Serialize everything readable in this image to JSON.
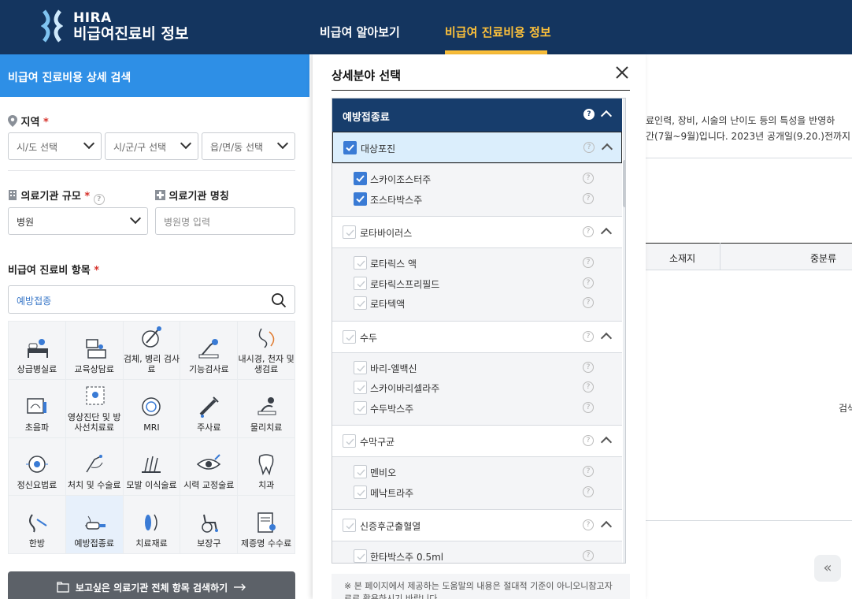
{
  "header": {
    "logo_line1": "HIRA",
    "logo_line2": "비급여진료비 정보",
    "nav": [
      "비급여 알아보기",
      "비급여 진료비용 정보"
    ],
    "colors": {
      "header_bg": "#14355f",
      "accent": "#ffc23a",
      "primary": "#2e8fe6"
    }
  },
  "left": {
    "title": "비급여 진료비용 상세 검색",
    "region_label": "지역",
    "req": "*",
    "region_selects": [
      "시/도 선택",
      "시/군/구 선택",
      "읍/면/동 선택"
    ],
    "scale_label": "의료기관 규모",
    "scale_value": "병원",
    "name_label": "의료기관 명칭",
    "name_placeholder": "병원명 입력",
    "items_label": "비급여 진료비 항목",
    "search_value": "예방접종",
    "grid": [
      {
        "label": "상급병실료",
        "icon": "bed-icon"
      },
      {
        "label": "교육상담료",
        "icon": "counseling-icon"
      },
      {
        "label": "검체, 병리 검사료",
        "icon": "lab-icon"
      },
      {
        "label": "기능검사료",
        "icon": "function-test-icon"
      },
      {
        "label": "내시경, 천자 및 생검료",
        "icon": "endoscope-icon"
      },
      {
        "label": "초음파",
        "icon": "ultrasound-icon"
      },
      {
        "label": "영상진단 및 방사선치료료",
        "icon": "radiology-icon"
      },
      {
        "label": "MRI",
        "icon": "mri-icon"
      },
      {
        "label": "주사료",
        "icon": "syringe-icon"
      },
      {
        "label": "물리치료",
        "icon": "physio-icon"
      },
      {
        "label": "정신요법료",
        "icon": "brain-icon"
      },
      {
        "label": "처치 및 수술료",
        "icon": "surgery-icon"
      },
      {
        "label": "모발 이식술료",
        "icon": "hair-icon"
      },
      {
        "label": "시력 교정술료",
        "icon": "eye-icon"
      },
      {
        "label": "치과",
        "icon": "tooth-icon"
      },
      {
        "label": "한방",
        "icon": "acupuncture-icon"
      },
      {
        "label": "예방접종료",
        "icon": "vaccine-icon"
      },
      {
        "label": "치료재료",
        "icon": "material-icon"
      },
      {
        "label": "보장구",
        "icon": "wheelchair-icon"
      },
      {
        "label": "제증명 수수료",
        "icon": "certificate-icon"
      }
    ],
    "bottom_button": "보고싶은 의료기관 전체 항목 검색하기"
  },
  "right_bg": {
    "text1": "료인력, 장비, 시술의 난이도 등의 특성을 반영하",
    "text2": "간(7월~9월)입니다. 2023년 공개일(9.20.)전까지",
    "col1": "소재지",
    "col2": "중분류",
    "side": "검색",
    "pager": "«"
  },
  "modal": {
    "title": "상세분야 선택",
    "group": "예방접종료",
    "categories": [
      {
        "label": "대상포진",
        "checked": true,
        "children": [
          {
            "label": "스카이조스터주",
            "checked": true
          },
          {
            "label": "조스타박스주",
            "checked": true
          }
        ]
      },
      {
        "label": "로타바이러스",
        "checked": false,
        "children": [
          {
            "label": "로타릭스 액",
            "checked": false
          },
          {
            "label": "로타릭스프리필드",
            "checked": false
          },
          {
            "label": "로타텍액",
            "checked": false
          }
        ]
      },
      {
        "label": "수두",
        "checked": false,
        "children": [
          {
            "label": "바리-엘백신",
            "checked": false
          },
          {
            "label": "스카이바리셀라주",
            "checked": false
          },
          {
            "label": "수두박스주",
            "checked": false
          }
        ]
      },
      {
        "label": "수막구균",
        "checked": false,
        "children": [
          {
            "label": "멘비오",
            "checked": false
          },
          {
            "label": "메낙트라주",
            "checked": false
          }
        ]
      },
      {
        "label": "신증후군출혈열",
        "checked": false,
        "children": [
          {
            "label": "한타박스주 0.5ml",
            "checked": false
          }
        ]
      }
    ],
    "help_glyph": "?",
    "note": "※ 본 페이지에서 제공하는 도움말의 내용은 절대적 기준이 아니오니참고자료로 활용하시기 바랍니다."
  }
}
